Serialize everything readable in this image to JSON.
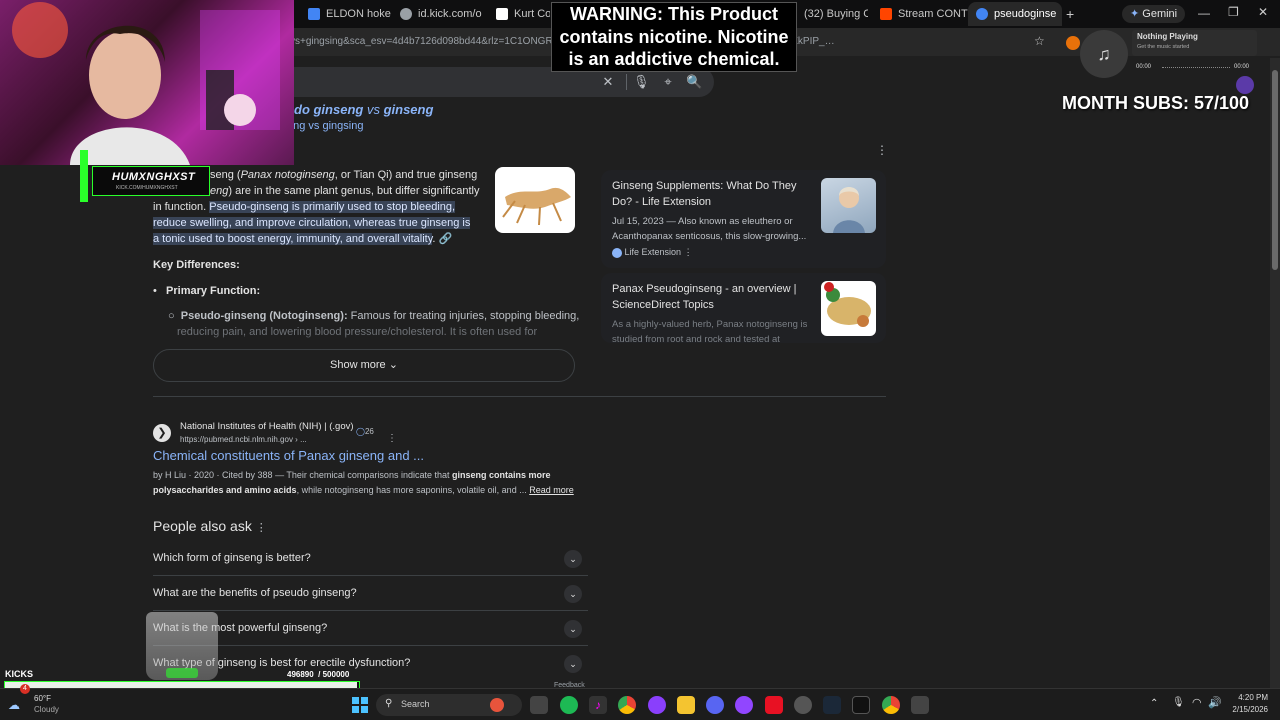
{
  "browser": {
    "tabs": [
      {
        "label": "ELDON hoke",
        "color": "#4285f4"
      },
      {
        "label": "id.kick.com/o",
        "color": "#9aa0a6"
      },
      {
        "label": "Kurt Cobain",
        "color": "#ffffff"
      },
      {
        "label": "(32) Buying C",
        "color": "#ff0000"
      },
      {
        "label": "Stream CONT",
        "color": "#ff4500"
      },
      {
        "label": "pseudoginse",
        "color": "#4285f4"
      }
    ],
    "gemini_label": "Gemini",
    "new_tab": "+",
    "url": "vs+gingsing&sca_esv=4d4b7126d098bd44&rlz=1C1ONGR_en…                                                    U-flzQ%3A1771201004036&ei=7GGSaZfzAYGZkPIP_…"
  },
  "search": {
    "clear_icon": "✕",
    "mic_icon": "🎙",
    "lens_icon": "⌖",
    "search_icon": "🔍"
  },
  "did_you_mean": {
    "showing_prefix": "do ginseng",
    "vs1": " vs ",
    "showing_suffix": "ginseng",
    "instead": "eng vs gingsing"
  },
  "overview": {
    "p1_a": "seng (",
    "p1_i": "Panax notoginseng",
    "p1_b": ", or Tian Qi) and true ginseng",
    "p2_a": "eng",
    "p2_b": ") are in the same plant genus, but differ significantly",
    "p3": "in function.",
    "hl1": "Pseudo-ginseng is primarily used to stop bleeding,",
    "hl2": "reduce swelling, and improve circulation, whereas true ginseng is",
    "hl3": "a tonic used to boost energy, immunity, and overall vitality",
    "hl_end": ".",
    "key_diff": "Key Differences:",
    "primary_function": "Primary Function:",
    "sub_bold": "Pseudo-ginseng (Notoginseng):",
    "sub_text": " Famous for treating injuries, stopping bleeding,",
    "sub_text2": "reducing pain, and lowering blood pressure/cholesterol. It is often used for",
    "show_more": "Show more"
  },
  "side_cards": [
    {
      "title": "Ginseng Supplements: What Do They Do? - Life Extension",
      "date": "Jul 15, 2023",
      "snippet1": " — Also known as eleuthero or",
      "snippet2": "Acanthopanax senticosus, this slow-growing...",
      "source": "Life Extension"
    },
    {
      "title": "Panax Pseudoginseng - an overview | ScienceDirect Topics",
      "snippet1": "As a highly-valued herb, Panax notoginseng is",
      "snippet2": "studied from root and rock and tested at"
    }
  ],
  "result": {
    "site": "National Institutes of Health (NIH) | (.gov)",
    "badge": "26",
    "url": "https://pubmed.ncbi.nlm.nih.gov › ...",
    "title": "Chemical constituents of Panax ginseng and ...",
    "meta": "by H Liu · 2020 · Cited by 388 — Their chemical comparisons indicate that ",
    "bold1": "ginseng contains more",
    "bold2": "polysaccharides and amino acids",
    "rest": ", while notoginseng has more saponins, volatile oil, and ... ",
    "read_more": "Read more"
  },
  "paa": {
    "heading": "People also ask",
    "questions": [
      "Which form of ginseng is better?",
      "What are the benefits of pseudo ginseng?",
      "What is the most powerful ginseng?",
      "What type of ginseng is best for erectile dysfunction?"
    ],
    "feedback": "Feedback"
  },
  "overlays": {
    "warning": "WARNING: This Product contains nicotine. Nicotine is an addictive chemical.",
    "month_subs": "MONTH SUBS: 57/100",
    "streamer_name": "HUMXNGHXST",
    "streamer_url": "KICK.COM/HUMXNGHXST",
    "kicks_label": "KICKS",
    "kicks_count": "496890",
    "kicks_goal": "/ 500000",
    "kicks_fraction": 0.99378,
    "music_title": "Nothing Playing",
    "music_sub": "Get the music started",
    "time_start": "00:00",
    "time_end": "00:00"
  },
  "taskbar": {
    "weather_temp": "60°F",
    "weather_desc": "Cloudy",
    "search_label": "Search",
    "time": "4:20 PM",
    "date": "2/15/2026"
  }
}
